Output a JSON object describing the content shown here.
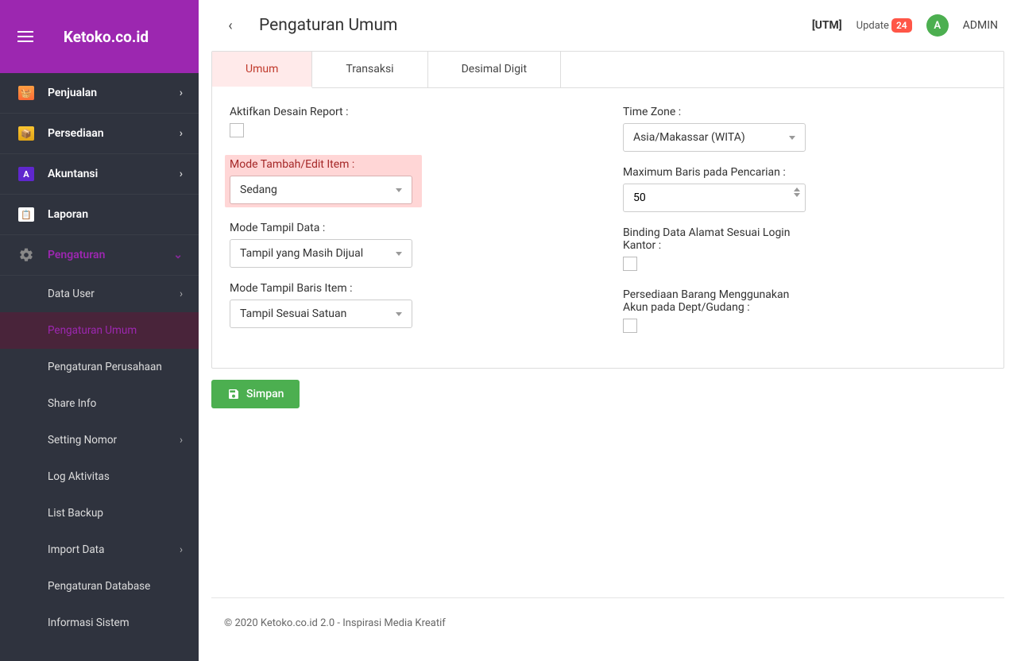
{
  "brand": "Ketoko.co.id",
  "page_title": "Pengaturan Umum",
  "topbar": {
    "utm": "[UTM]",
    "update_label": "Update",
    "update_count": "24",
    "avatar_letter": "A",
    "username": "ADMIN"
  },
  "nav": [
    {
      "label": "Penjualan",
      "has_children": true
    },
    {
      "label": "Persediaan",
      "has_children": true
    },
    {
      "label": "Akuntansi",
      "has_children": true
    },
    {
      "label": "Laporan",
      "has_children": false
    },
    {
      "label": "Pengaturan",
      "has_children": true,
      "expanded": true
    }
  ],
  "subnav": {
    "items": [
      {
        "label": "Data User",
        "has_children": true
      },
      {
        "label": "Pengaturan Umum",
        "active": true
      },
      {
        "label": "Pengaturan Perusahaan"
      },
      {
        "label": "Share Info"
      },
      {
        "label": "Setting Nomor",
        "has_children": true
      },
      {
        "label": "Log Aktivitas"
      },
      {
        "label": "List Backup"
      },
      {
        "label": "Import Data",
        "has_children": true
      },
      {
        "label": "Pengaturan Database"
      },
      {
        "label": "Informasi Sistem"
      }
    ]
  },
  "tabs": [
    {
      "label": "Umum",
      "active": true
    },
    {
      "label": "Transaksi"
    },
    {
      "label": "Desimal Digit"
    }
  ],
  "form": {
    "left": {
      "aktifkan_report_label": "Aktifkan Desain Report :",
      "mode_tambah_label": "Mode Tambah/Edit Item :",
      "mode_tambah_value": "Sedang",
      "mode_tampil_data_label": "Mode Tampil Data :",
      "mode_tampil_data_value": "Tampil yang Masih Dijual",
      "mode_baris_label": "Mode Tampil Baris Item :",
      "mode_baris_value": "Tampil Sesuai Satuan"
    },
    "right": {
      "timezone_label": "Time Zone :",
      "timezone_value": "Asia/Makassar (WITA)",
      "max_baris_label": "Maximum Baris pada Pencarian :",
      "max_baris_value": "50",
      "binding_label": "Binding Data Alamat Sesuai Login Kantor :",
      "persediaan_label": "Persediaan Barang Menggunakan Akun pada Dept/Gudang :"
    },
    "save_label": "Simpan"
  },
  "footer": "© 2020 Ketoko.co.id 2.0 - Inspirasi Media Kreatif"
}
